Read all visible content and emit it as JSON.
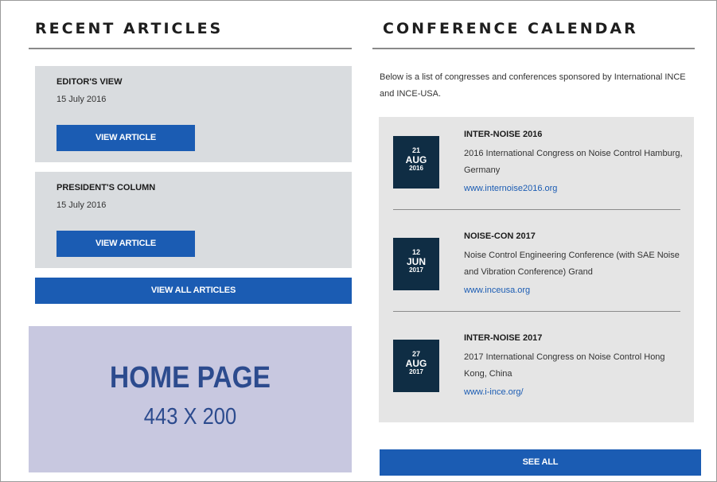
{
  "left": {
    "title": "RECENT ARTICLES",
    "articles": [
      {
        "title": "EDITOR'S VIEW",
        "date": "15 July 2016",
        "button": "VIEW ARTICLE"
      },
      {
        "title": "PRESIDENT'S COLUMN",
        "date": "15 July 2016",
        "button": "VIEW ARTICLE"
      }
    ],
    "view_all": "VIEW ALL ARTICLES",
    "ad": {
      "line1": "HOME PAGE",
      "line2": "443 X 200"
    }
  },
  "right": {
    "title": "CONFERENCE CALENDAR",
    "intro": "Below is a list of congresses and conferences sponsored by International INCE and INCE-USA.",
    "events": [
      {
        "day": "21",
        "month": "AUG",
        "year": "2016",
        "name": "INTER-NOISE 2016",
        "desc": "2016 International Congress on Noise Control Hamburg, Germany",
        "link": "www.internoise2016.org"
      },
      {
        "day": "12",
        "month": "JUN",
        "year": "2017",
        "name": "NOISE-CON 2017",
        "desc": "Noise Control Engineering Conference (with SAE Noise and Vibration Conference) Grand",
        "link": "www.inceusa.org"
      },
      {
        "day": "27",
        "month": "AUG",
        "year": "2017",
        "name": "INTER-NOISE 2017",
        "desc": "2017 International Congress on Noise Control Hong Kong, China",
        "link": "www.i-ince.org/"
      }
    ],
    "see_all": "SEE ALL"
  },
  "colors": {
    "accent_blue": "#1b5cb3",
    "badge_navy": "#0f2d44",
    "card_gray": "#d9dcdf",
    "panel_gray": "#e5e5e5",
    "ad_lavender": "#c8c8e0",
    "ad_text": "#2c4b8e"
  }
}
